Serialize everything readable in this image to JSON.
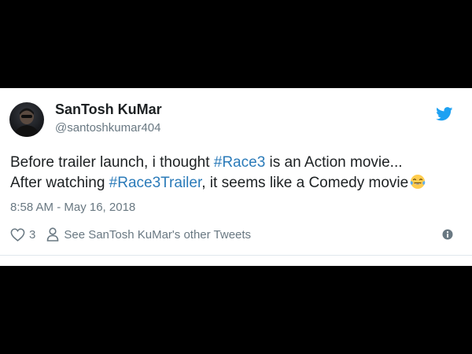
{
  "tweet": {
    "display_name": "SanTosh KuMar",
    "handle": "@santoshkumar404",
    "text": {
      "line1_before": "Before trailer launch, i thought ",
      "line1_hashtag": "#Race3",
      "line1_after": " is an Action movie...",
      "line2_before": "After watching ",
      "line2_hashtag": "#Race3Trailer",
      "line2_after": ", it seems like a Comedy movie",
      "emoji": "face-with-tears-of-joy"
    },
    "timestamp": "8:58 AM - May 16, 2018",
    "like_count": "3",
    "other_tweets_label": "See SanTosh KuMar's other Tweets"
  },
  "icons": {
    "avatar": "avatar",
    "brand": "twitter-bird-icon",
    "like": "heart-icon",
    "profile": "person-icon",
    "info": "info-icon"
  },
  "colors": {
    "text": "#1c2022",
    "secondary": "#697882",
    "hashtag": "#2b7bb9",
    "twitter_blue": "#1da1f2",
    "background": "#000000",
    "card": "#ffffff"
  }
}
